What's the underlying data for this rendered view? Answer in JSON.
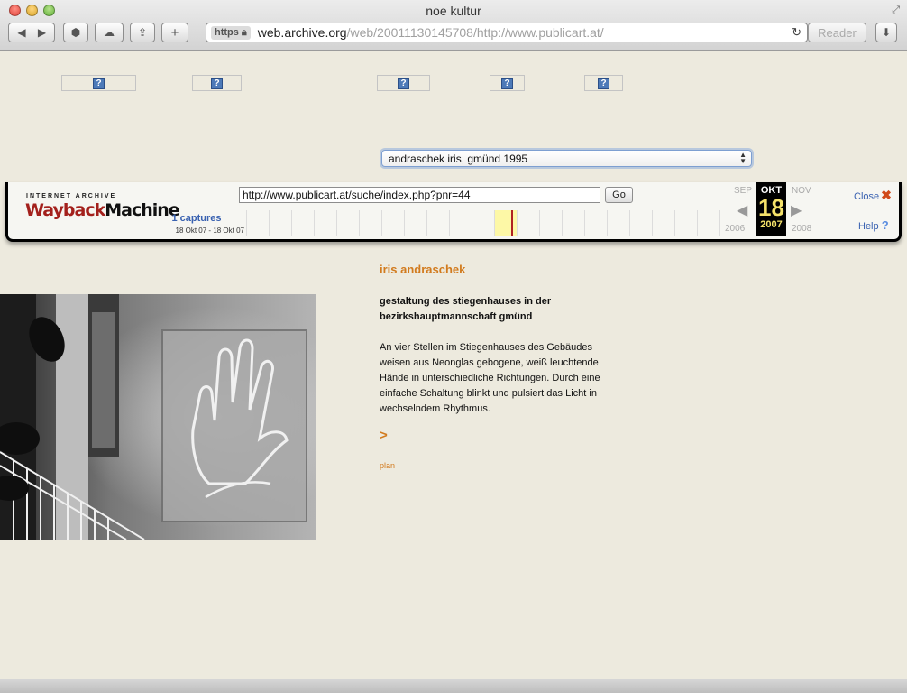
{
  "window": {
    "title": "noe kultur"
  },
  "toolbar": {
    "https_label": "https",
    "url_host": "web.archive.org",
    "url_path": "/web/20011130145708/http://www.publicart.at/",
    "reader_label": "Reader"
  },
  "page": {
    "artist_select": {
      "value": "andraschek iris, gmünd 1995"
    },
    "nav_images": [
      "?",
      "?",
      "?",
      "?",
      "?"
    ],
    "artist_name": "iris andraschek",
    "project_title": "gestaltung des stiegenhauses in der bezirkshauptmannschaft gmünd",
    "description": "An vier Stellen im Stiegenhauses des Gebäudes weisen aus Neonglas gebogene, weiß leuchtende Hände in unterschiedliche Richtungen. Durch eine einfache Schaltung blinkt und pulsiert das Licht in wechselndem Rhythmus.",
    "more_link": ">",
    "plan_link": "plan"
  },
  "wayback": {
    "brand_top": "INTERNET ARCHIVE",
    "brand_red": "Wayback",
    "brand_black": "Machine",
    "url_value": "http://www.publicart.at/suche/index.php?pnr=44",
    "go_label": "Go",
    "captures": "1 captures",
    "range": "18 Okt 07 - 18 Okt 07",
    "prev_month": "SEP",
    "active_month": "OKT",
    "active_day": "18",
    "active_year": "2007",
    "next_month": "NOV",
    "prev_year": "2006",
    "next_year": "2008",
    "close_label": "Close",
    "close_icon": "✖",
    "help_label": "Help",
    "help_icon": "?"
  },
  "colors": {
    "page_bg": "#edeade",
    "accent_orange": "#d27b1e",
    "wayback_blue": "#3a62b1",
    "wayback_red": "#a3201c",
    "active_date_yellow": "#f5e26a"
  }
}
